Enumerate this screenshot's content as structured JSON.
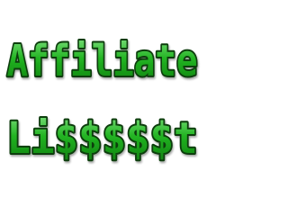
{
  "logo": {
    "line1": "Affiliate",
    "line2": "Li$$$$$t",
    "colors": {
      "fill_light": "#7ee07e",
      "fill_main": "#22b422",
      "fill_dark": "#0f7d0f",
      "outline": "#0c3d0c",
      "background": "#ffffff"
    }
  }
}
